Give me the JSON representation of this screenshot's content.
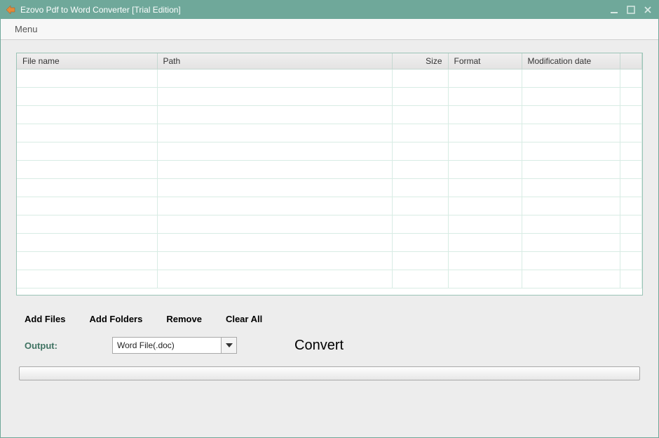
{
  "window": {
    "title": "Ezovo Pdf to Word Converter [Trial Edition]"
  },
  "menubar": {
    "menu_label": "Menu"
  },
  "table": {
    "headers": {
      "filename": "File name",
      "path": "Path",
      "size": "Size",
      "format": "Format",
      "moddate": "Modification date"
    },
    "rows": []
  },
  "actions": {
    "add_files": "Add Files",
    "add_folders": "Add Folders",
    "remove": "Remove",
    "clear_all": "Clear All"
  },
  "output": {
    "label": "Output:",
    "selected": "Word File(.doc)"
  },
  "convert": {
    "label": "Convert"
  }
}
